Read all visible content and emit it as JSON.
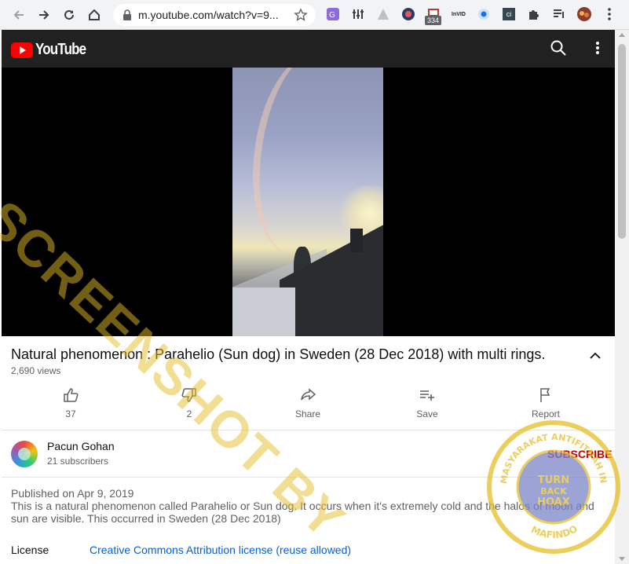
{
  "browser": {
    "url": "m.youtube.com/watch?v=9...",
    "extension_badge": "334",
    "ext_invid": "InVID",
    "ext_ci": "ci"
  },
  "youtube": {
    "logo_text": "YouTube"
  },
  "video": {
    "title": "Natural phenomenon : Parahelio (Sun dog) in Sweden (28 Dec 2018) with multi rings.",
    "views": "2,690 views",
    "actions": [
      {
        "label": "37"
      },
      {
        "label": "2"
      },
      {
        "label": "Share"
      },
      {
        "label": "Save"
      },
      {
        "label": "Report"
      }
    ]
  },
  "channel": {
    "name": "Pacun Gohan",
    "subscribers": "21 subscribers",
    "subscribe_label": "SUBSCRIBE"
  },
  "description": {
    "published": "Published on Apr 9, 2019",
    "text": "This is a natural phenomenon called Parahelio or Sun dog. It occurs when it's extremely cold and the halos of moon and sun are visible. This occurred in Sweden (28 Dec 2018)",
    "license_label": "License",
    "license_value": "Creative Commons Attribution license (reuse allowed)"
  },
  "watermark": {
    "diagonal_text": "SCREENSHOT BY",
    "seal_text_top": "MASYARAKAT ANTIFITNAH INDONESIA",
    "seal_text_bottom": "MAFINDO",
    "seal_center": "TURN BACK HOAX"
  },
  "colors": {
    "yt_red": "#ff0000",
    "subscribe_red": "#cc0000",
    "link_blue": "#065fd4",
    "watermark_gold": "#e6be28"
  }
}
